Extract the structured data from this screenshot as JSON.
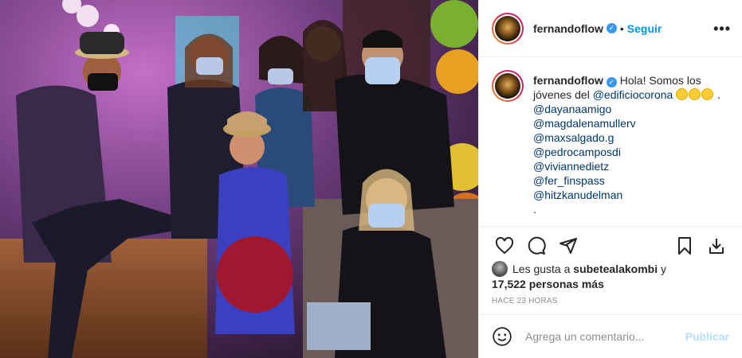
{
  "post": {
    "image_alt": "",
    "author": "fernandoflow",
    "follow_label": "Seguir",
    "more_label": "•••",
    "caption": {
      "author": "fernandoflow",
      "line1": "Hola! Somos los jóvenes del",
      "mention_main": "@edificiocorona",
      "trailing": ".",
      "mentions": [
        "@dayanaamigo",
        "@magdalenamullerv",
        "@maxsalgado.g",
        "@pedrocamposdi",
        "@viviannedietz",
        "@fer_finspass",
        "@hitzkanudelman"
      ],
      "end_dot": "."
    },
    "likes": {
      "prefix": "Les gusta a",
      "user": "subetealakombi",
      "connector": "y",
      "count": "17,522 personas más"
    },
    "time": "HACE 23 HORAS",
    "comment": {
      "placeholder": "Agrega un comentario...",
      "publish_label": "Publicar"
    }
  },
  "colors": {
    "link": "#0095f6",
    "mention": "#00376b",
    "muted": "#8e8e8e",
    "publish_disabled": "#b2dffc",
    "verified": "#3897f0"
  }
}
